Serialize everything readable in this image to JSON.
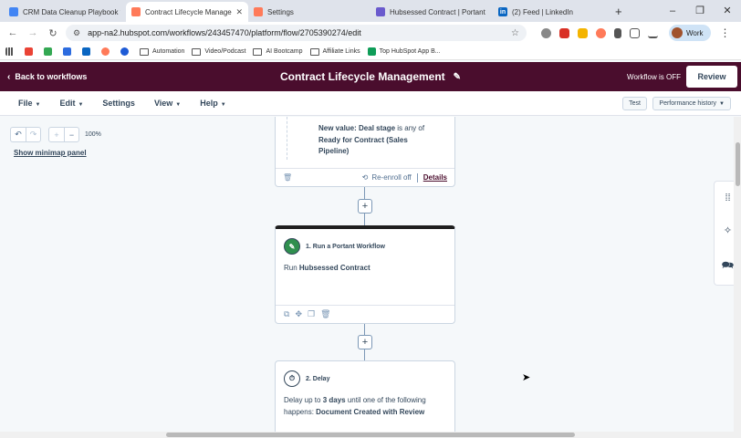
{
  "browser": {
    "tabs": [
      {
        "label": "CRM Data Cleanup Playbook fo",
        "favicon_color": "#4285f4",
        "active": false
      },
      {
        "label": "Contract Lifecycle Manageme",
        "favicon_color": "#ff7a59",
        "active": true
      },
      {
        "label": "Settings",
        "favicon_color": "#ff7a59",
        "active": false
      },
      {
        "label": "Hubsessed Contract | Portant",
        "favicon_color": "#6a5acd",
        "active": false
      },
      {
        "label": "(2) Feed | LinkedIn",
        "favicon_color": "#0a66c2",
        "active": false
      }
    ],
    "url": "app-na2.hubspot.com/workflows/243457470/platform/flow/2705390274/edit",
    "profile_label": "Work",
    "bookmarks": [
      {
        "label": "",
        "type": "apps",
        "color": "#555"
      },
      {
        "label": "",
        "type": "gmail",
        "color": "#ea4335"
      },
      {
        "label": "",
        "type": "drive",
        "color": "#34a853"
      },
      {
        "label": "",
        "type": "ext",
        "color": "#2d6cdf"
      },
      {
        "label": "",
        "type": "linkedin",
        "color": "#0a66c2"
      },
      {
        "label": "",
        "type": "hubspot",
        "color": "#ff7a59"
      },
      {
        "label": "",
        "type": "ext",
        "color": "#1e5bd6"
      },
      {
        "label": "Automation",
        "type": "folder"
      },
      {
        "label": "Video/Podcast",
        "type": "folder"
      },
      {
        "label": "AI Bootcamp",
        "type": "folder"
      },
      {
        "label": "Affiliate Links",
        "type": "folder"
      },
      {
        "label": "Top HubSpot App B...",
        "type": "sheet",
        "color": "#0f9d58"
      }
    ]
  },
  "header": {
    "back_label": "Back to workflows",
    "title": "Contract Lifecycle Management",
    "status": "Workflow is OFF",
    "review_label": "Review"
  },
  "menubar": {
    "file": "File",
    "edit": "Edit",
    "settings": "Settings",
    "view": "View",
    "help": "Help",
    "test": "Test",
    "performance": "Performance history"
  },
  "canvas": {
    "zoom": "100%",
    "minimap_label": "Show minimap panel"
  },
  "cards": {
    "trigger": {
      "line1_bold": "New value: Deal stage",
      "line1_rest": " is any of",
      "line2": "Ready for Contract (Sales",
      "line3": "Pipeline)",
      "reenroll": "Re-enroll off",
      "details": "Details"
    },
    "action1": {
      "title": "1. Run a Portant Workflow",
      "body_prefix": "Run ",
      "body_bold": "Hubsessed Contract"
    },
    "action2": {
      "title": "2. Delay",
      "body_prefix": "Delay up to ",
      "body_bold1": "3 days",
      "body_mid": " until one of the following",
      "body_line2_prefix": "happens: ",
      "body_bold2": "Document Created with Review"
    }
  },
  "colors": {
    "header_bg": "#4a0d2d",
    "canvas_bg": "#f5f8fa",
    "accent": "#ff7a59"
  }
}
